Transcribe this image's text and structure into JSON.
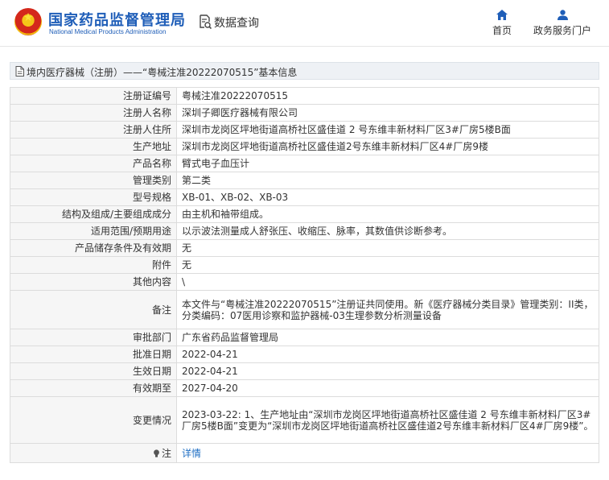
{
  "header": {
    "brand_cn": "国家药品监督管理局",
    "brand_en": "National Medical Products Administration",
    "query_label": "数据查询",
    "nav_home": "首页",
    "nav_portal": "政务服务门户"
  },
  "title": "境内医疗器械（注册）——“粤械注准20222070515”基本信息",
  "rows": [
    {
      "label": "注册证编号",
      "value": "粤械注准20222070515"
    },
    {
      "label": "注册人名称",
      "value": "深圳子卿医疗器械有限公司"
    },
    {
      "label": "注册人住所",
      "value": "深圳市龙岗区坪地街道高桥社区盛佳道 2 号东维丰新材料厂区3#厂房5楼B面"
    },
    {
      "label": "生产地址",
      "value": "深圳市龙岗区坪地街道高桥社区盛佳道2号东维丰新材料厂区4#厂房9楼"
    },
    {
      "label": "产品名称",
      "value": "臂式电子血压计"
    },
    {
      "label": "管理类别",
      "value": "第二类"
    },
    {
      "label": "型号规格",
      "value": "XB-01、XB-02、XB-03"
    },
    {
      "label": "结构及组成/主要组成成分",
      "value": "由主机和袖带组成。"
    },
    {
      "label": "适用范围/预期用途",
      "value": "以示波法测量成人舒张压、收缩压、脉率，其数值供诊断参考。"
    },
    {
      "label": "产品储存条件及有效期",
      "value": "无"
    },
    {
      "label": "附件",
      "value": "无"
    },
    {
      "label": "其他内容",
      "value": "\\"
    },
    {
      "label": "备注",
      "value": "本文件与“粤械注准20222070515”注册证共同使用。新《医疗器械分类目录》管理类别：II类，分类编码：07医用诊察和监护器械-03生理参数分析测量设备"
    },
    {
      "label": "审批部门",
      "value": "广东省药品监督管理局"
    },
    {
      "label": "批准日期",
      "value": "2022-04-21"
    },
    {
      "label": "生效日期",
      "value": "2022-04-21"
    },
    {
      "label": "有效期至",
      "value": "2027-04-20"
    },
    {
      "label": "变更情况",
      "value": "2023-03-22: 1、生产地址由“深圳市龙岗区坪地街道高桥社区盛佳道 2 号东维丰新材料厂区3#厂房5楼B面”变更为“深圳市龙岗区坪地街道高桥社区盛佳道2号东维丰新材料厂区4#厂房9楼”。"
    }
  ],
  "note": {
    "label": "注",
    "link_text": "详情"
  },
  "colors": {
    "brand_blue": "#1f5eb8",
    "link_blue": "#1f6fc4",
    "label_bg": "#f6f6f6",
    "border": "#dcdcdc"
  },
  "icons": [
    "national-emblem-icon",
    "data-query-icon",
    "home-icon",
    "user-icon",
    "document-icon",
    "lightbulb-icon"
  ]
}
